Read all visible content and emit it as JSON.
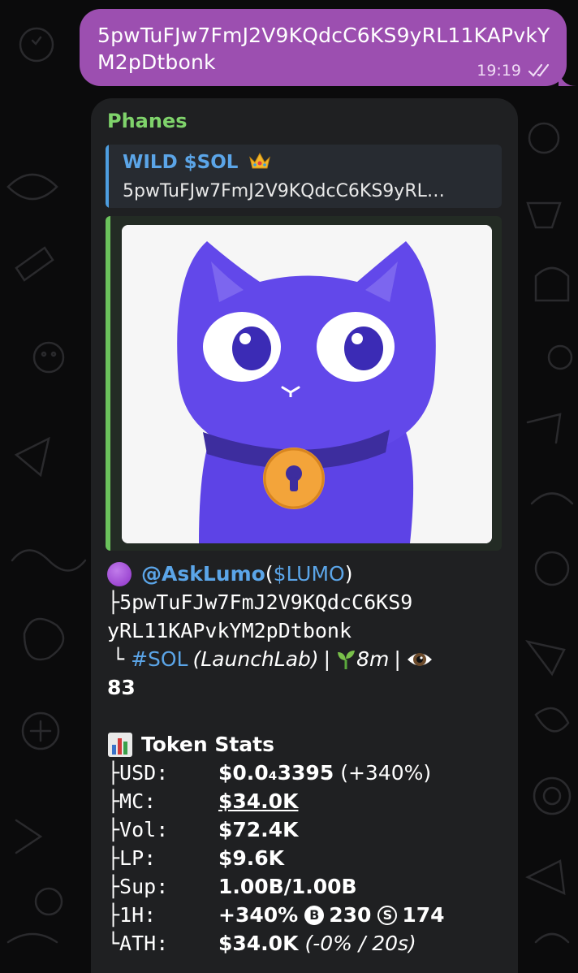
{
  "outgoing": {
    "text": "5pwTuFJw7FmJ2V9KQdcC6KS9yRL11KAPvkYM2pDtbonk",
    "time": "19:19",
    "status_icon": "double-check-icon"
  },
  "incoming": {
    "sender": "Phanes",
    "reply": {
      "title": "WILD $SOL",
      "title_icon": "crown-icon",
      "text": "5pwTuFJw7FmJ2V9KQdcC6KS9yRL…"
    },
    "preview_image": "purple-cat-mascot-with-golden-bell",
    "token": {
      "icon": "purple-circle-icon",
      "handle": "@AskLumo",
      "ticker_open": " (",
      "ticker": "$LUMO",
      "ticker_close": ")",
      "address_prefix": "├",
      "address_line1": "5pwTuFJw7FmJ2V9KQdcC6KS9",
      "address_line2": "yRL11KAPvkYM2pDtbonk",
      "meta_prefix": "└",
      "chain": "#SOL",
      "platform": "(LaunchLab)",
      "sep1": "|",
      "age_icon": "seedling-icon",
      "age": "8m",
      "sep2": "|",
      "views_icon": "eye-icon",
      "views": "83"
    },
    "stats": {
      "icon": "bar-chart-icon",
      "title": "Token Stats",
      "rows": [
        {
          "key": "├USD:",
          "value": "$0.0₄3395",
          "extra": "(+340%)"
        },
        {
          "key": "├MC:",
          "value": "$34.0K"
        },
        {
          "key": "├Vol:",
          "value": "$72.4K"
        },
        {
          "key": "├LP:",
          "value": "$9.6K"
        },
        {
          "key": "├Sup:",
          "value": "1.00B/1.00B"
        },
        {
          "key": "├1H:",
          "value": "+340%",
          "b_badge": "B",
          "b_count": "230",
          "s_badge": "S",
          "s_count": "174"
        },
        {
          "key": "└ATH:",
          "value": "$34.0K",
          "extra": "(-0% / 20s)"
        }
      ]
    }
  }
}
